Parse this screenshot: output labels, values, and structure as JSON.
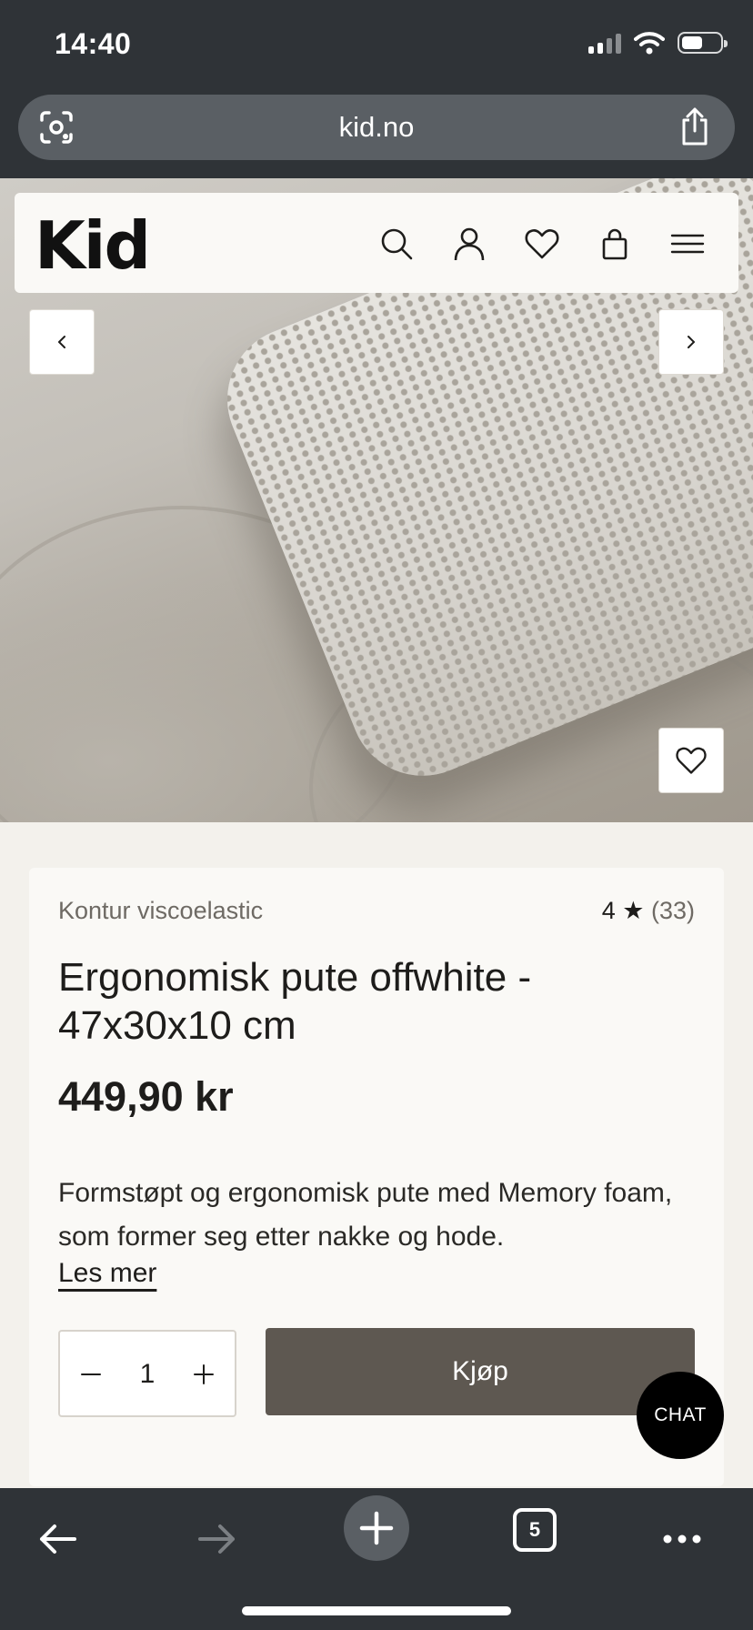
{
  "status_bar": {
    "time": "14:40"
  },
  "browser": {
    "url": "kid.no",
    "tab_count": "5"
  },
  "header": {
    "logo": "Kid"
  },
  "product": {
    "brand": "Kontur viscoelastic",
    "rating_score": "4 ★",
    "rating_count": "(33)",
    "title": "Ergonomisk pute offwhite - 47x30x10 cm",
    "price": "449,90 kr",
    "description": "Formstøpt og ergonomisk pute med Memory foam, som former seg etter nakke og hode.",
    "read_more": "Les mer",
    "quantity": "1",
    "buy_label": "Kjøp"
  },
  "chat": {
    "label": "CHAT"
  },
  "colors": {
    "chrome": "#2f3337",
    "page_background": "#f3f1ec",
    "card_background": "#faf9f6",
    "buy_button": "#5e5851",
    "chat_button": "#000000"
  },
  "icons": {
    "header": [
      "search-icon",
      "account-icon",
      "wishlist-icon",
      "cart-icon",
      "menu-icon"
    ],
    "gallery": [
      "chevron-left-icon",
      "chevron-right-icon",
      "heart-icon"
    ],
    "toolbar": [
      "back-arrow-icon",
      "forward-arrow-icon",
      "plus-icon",
      "tabs-icon",
      "more-icon"
    ]
  }
}
